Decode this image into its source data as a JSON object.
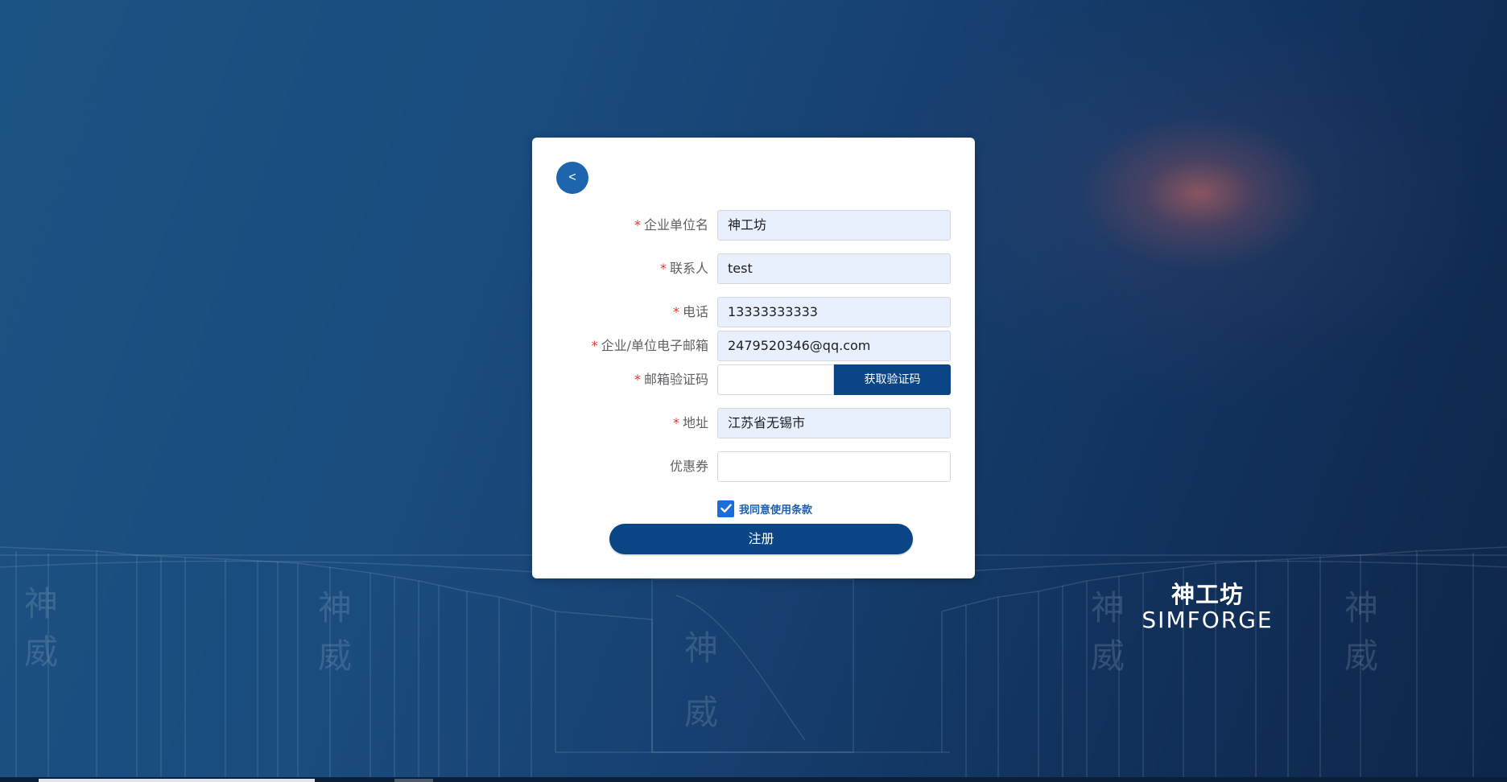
{
  "brand": {
    "name_cn": "神工坊",
    "name_en": "SIMFORGE"
  },
  "form": {
    "back_label": "<",
    "required_mark": "*",
    "fields": {
      "company": {
        "label": "企业单位名",
        "value": "神工坊",
        "required": true
      },
      "contact": {
        "label": "联系人",
        "value": "test",
        "required": true
      },
      "phone": {
        "label": "电话",
        "value": "13333333333",
        "required": true
      },
      "email": {
        "label": "企业/单位电子邮箱",
        "value": "2479520346@qq.com",
        "required": true
      },
      "email_code": {
        "label": "邮箱验证码",
        "value": "",
        "required": true,
        "button_label": "获取验证码"
      },
      "address": {
        "label": "地址",
        "value": "江苏省无锡市",
        "required": true
      },
      "coupon": {
        "label": "优惠券",
        "value": "",
        "required": false
      }
    },
    "agree": {
      "checked": true,
      "label": "我同意使用条款"
    },
    "submit_label": "注册"
  },
  "colors": {
    "primary": "#0a4586",
    "back_button": "#1d65ad",
    "checkbox": "#1a6fd6",
    "required": "#e5342f",
    "autofill_background": "#e8f0fe"
  }
}
